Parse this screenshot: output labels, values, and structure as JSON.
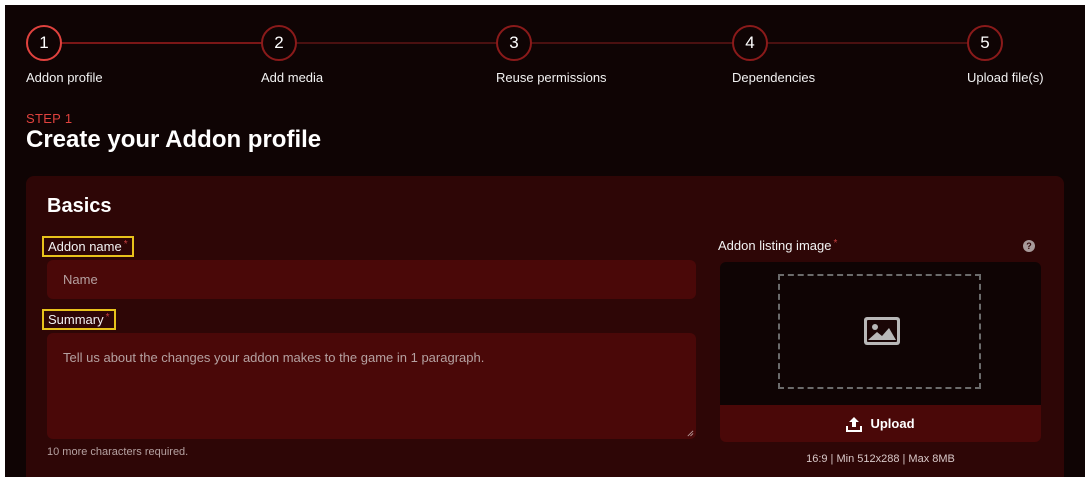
{
  "steps": [
    {
      "number": "1",
      "label": "Addon profile"
    },
    {
      "number": "2",
      "label": "Add media"
    },
    {
      "number": "3",
      "label": "Reuse permissions"
    },
    {
      "number": "4",
      "label": "Dependencies"
    },
    {
      "number": "5",
      "label": "Upload file(s)"
    }
  ],
  "header": {
    "eyebrow": "STEP 1",
    "title": "Create your Addon profile"
  },
  "basics": {
    "title": "Basics",
    "name_label": "Addon name",
    "name_placeholder": "Name",
    "summary_label": "Summary",
    "summary_placeholder": "Tell us about the changes your addon makes to the game in 1 paragraph.",
    "summary_helper": "10 more characters required.",
    "required_mark": "*",
    "image_label": "Addon listing image",
    "upload_label": "Upload",
    "image_hint": "16:9 | Min 512x288 | Max 8MB"
  },
  "icons": {
    "help": "question-circle-icon",
    "image": "image-placeholder-icon",
    "upload": "upload-icon"
  },
  "colors": {
    "accent": "#e0423e",
    "background": "#0f0404",
    "card": "#2e0606",
    "input": "#4a0808",
    "highlight": "#e8c21b"
  }
}
